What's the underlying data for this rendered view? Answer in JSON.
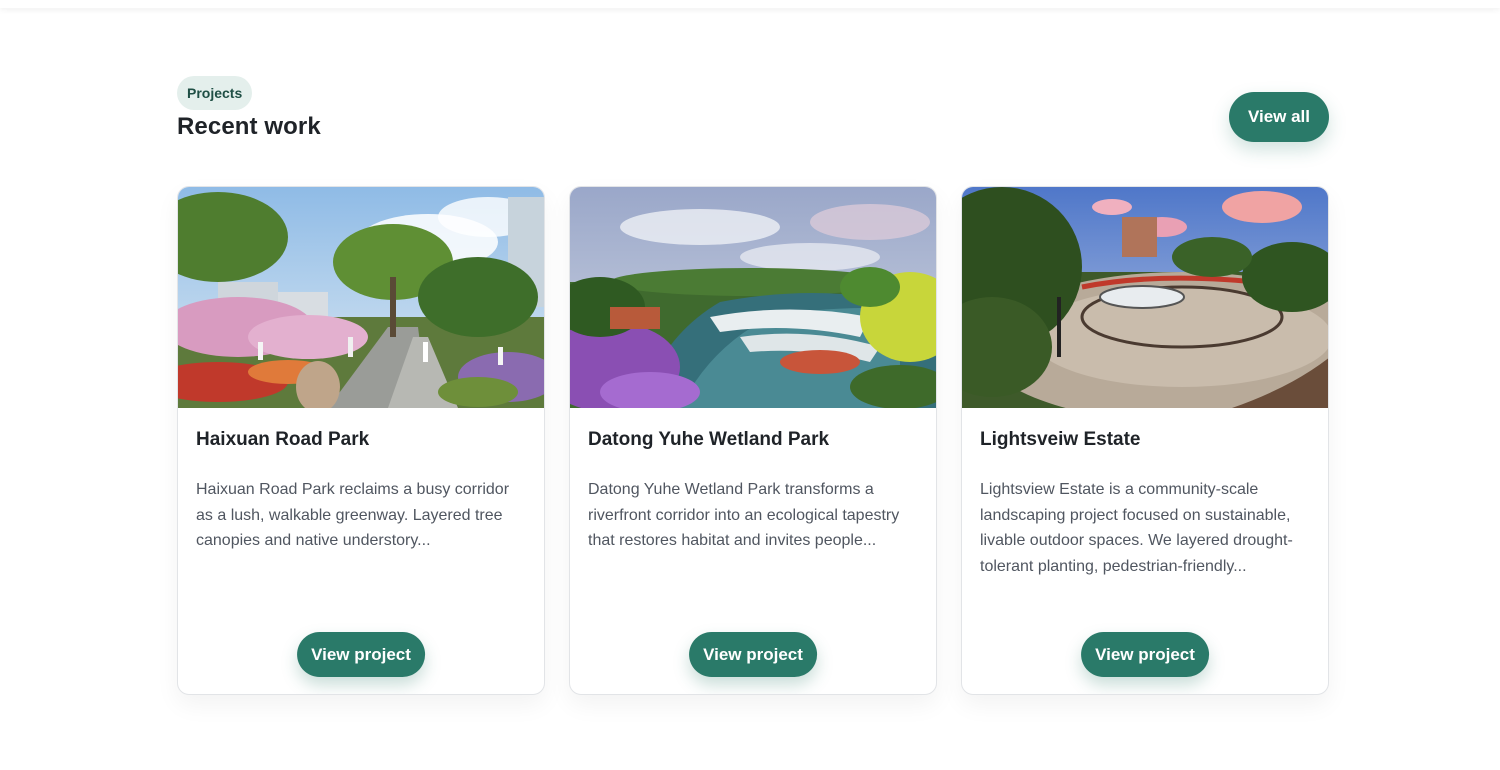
{
  "section": {
    "eyebrow": "Projects",
    "title": "Recent work",
    "view_all_label": "View all"
  },
  "projects": [
    {
      "title": "Haixuan Road Park",
      "description": "Haixuan Road Park reclaims a busy corridor as a lush, walkable greenway. Layered tree canopies and native understory...",
      "button_label": "View project",
      "image_alt": "Tree-lined greenway walkway with blossoming trees and pedestrians"
    },
    {
      "title": "Datong Yuhe Wetland Park",
      "description": "Datong Yuhe Wetland Park transforms a riverfront corridor into an ecological tapestry that restores habitat and invites people...",
      "button_label": "View project",
      "image_alt": "Riverfront wetland with terraced banks and purple flowering plants"
    },
    {
      "title": "Lightsveiw Estate",
      "description": "Lightsview Estate is a community-scale landscaping project focused on sustainable, livable outdoor spaces. We layered drought-tolerant planting, pedestrian-friendly...",
      "button_label": "View project",
      "image_alt": "Circular plaza with fountain surrounded by trees at dusk"
    }
  ],
  "colors": {
    "accent": "#2a7a69",
    "eyebrow_bg": "#e4efec",
    "eyebrow_text": "#1f4f45",
    "heading": "#1f2328",
    "body_text": "#505660",
    "card_border": "#e2e4e7"
  }
}
